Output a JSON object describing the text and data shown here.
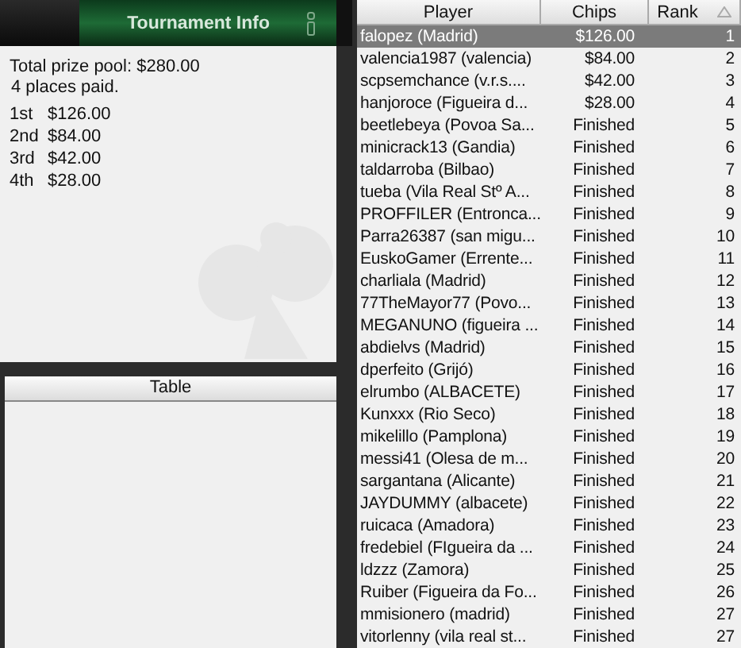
{
  "header": {
    "tab_label": "Tournament Info"
  },
  "info": {
    "prize_pool": "Total prize pool: $280.00",
    "places_paid": "4 places paid.",
    "payouts": [
      {
        "place": "1st",
        "amount": "$126.00"
      },
      {
        "place": "2nd",
        "amount": "$84.00"
      },
      {
        "place": "3rd",
        "amount": "$42.00"
      },
      {
        "place": "4th",
        "amount": "$28.00"
      }
    ]
  },
  "table_panel": {
    "title": "Table"
  },
  "players": {
    "columns": [
      "Player",
      "Chips",
      "Rank"
    ],
    "rows": [
      {
        "player": "falopez (Madrid)",
        "chips": "$126.00",
        "rank": "1",
        "selected": true
      },
      {
        "player": "valencia1987 (valencia)",
        "chips": "$84.00",
        "rank": "2",
        "selected": false
      },
      {
        "player": "scpsemchance (v.r.s....",
        "chips": "$42.00",
        "rank": "3",
        "selected": false
      },
      {
        "player": "hanjoroce (Figueira d...",
        "chips": "$28.00",
        "rank": "4",
        "selected": false
      },
      {
        "player": "beetlebeya (Povoa Sa...",
        "chips": "Finished",
        "rank": "5",
        "selected": false
      },
      {
        "player": "minicrack13 (Gandia)",
        "chips": "Finished",
        "rank": "6",
        "selected": false
      },
      {
        "player": "taldarroba (Bilbao)",
        "chips": "Finished",
        "rank": "7",
        "selected": false
      },
      {
        "player": "tueba (Vila Real Stº A...",
        "chips": "Finished",
        "rank": "8",
        "selected": false
      },
      {
        "player": "PROFFILER (Entronca...",
        "chips": "Finished",
        "rank": "9",
        "selected": false
      },
      {
        "player": "Parra26387 (san migu...",
        "chips": "Finished",
        "rank": "10",
        "selected": false
      },
      {
        "player": "EuskoGamer (Errente...",
        "chips": "Finished",
        "rank": "11",
        "selected": false
      },
      {
        "player": "charliala (Madrid)",
        "chips": "Finished",
        "rank": "12",
        "selected": false
      },
      {
        "player": "77TheMayor77 (Povo...",
        "chips": "Finished",
        "rank": "13",
        "selected": false
      },
      {
        "player": "MEGANUNO (figueira ...",
        "chips": "Finished",
        "rank": "14",
        "selected": false
      },
      {
        "player": "abdielvs (Madrid)",
        "chips": "Finished",
        "rank": "15",
        "selected": false
      },
      {
        "player": "dperfeito (Grijó)",
        "chips": "Finished",
        "rank": "16",
        "selected": false
      },
      {
        "player": "elrumbo (ALBACETE)",
        "chips": "Finished",
        "rank": "17",
        "selected": false
      },
      {
        "player": "Kunxxx (Rio Seco)",
        "chips": "Finished",
        "rank": "18",
        "selected": false
      },
      {
        "player": "mikelillo (Pamplona)",
        "chips": "Finished",
        "rank": "19",
        "selected": false
      },
      {
        "player": "messi41 (Olesa de m...",
        "chips": "Finished",
        "rank": "20",
        "selected": false
      },
      {
        "player": "sargantana (Alicante)",
        "chips": "Finished",
        "rank": "21",
        "selected": false
      },
      {
        "player": "JAYDUMMY (albacete)",
        "chips": "Finished",
        "rank": "22",
        "selected": false
      },
      {
        "player": "ruicaca (Amadora)",
        "chips": "Finished",
        "rank": "23",
        "selected": false
      },
      {
        "player": "fredebiel (FIgueira da ...",
        "chips": "Finished",
        "rank": "24",
        "selected": false
      },
      {
        "player": "ldzzz (Zamora)",
        "chips": "Finished",
        "rank": "25",
        "selected": false
      },
      {
        "player": "Ruiber (Figueira da Fo...",
        "chips": "Finished",
        "rank": "26",
        "selected": false
      },
      {
        "player": "mmisionero (madrid)",
        "chips": "Finished",
        "rank": "27",
        "selected": false
      },
      {
        "player": "vitorlenny (vila real st...",
        "chips": "Finished",
        "rank": "27",
        "selected": false
      }
    ]
  }
}
